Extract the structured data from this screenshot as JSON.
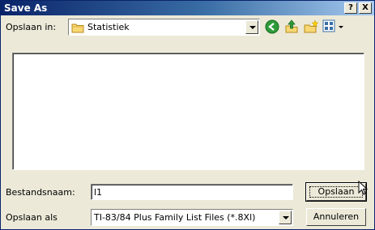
{
  "window": {
    "title": "Save As"
  },
  "titlebar_buttons": {
    "help": "?",
    "close": "X"
  },
  "lookin": {
    "label": "Opslaan in:",
    "folder": "Statistiek"
  },
  "toolbar": {
    "icons": [
      "back-icon",
      "up-folder-icon",
      "new-folder-icon",
      "views-menu-icon"
    ]
  },
  "filename": {
    "label": "Bestandsnaam:",
    "value": "l1"
  },
  "filetype": {
    "label": "Opslaan als",
    "value": "TI-83/84 Plus Family List Files (*.8Xl)"
  },
  "buttons": {
    "save": "Opslaan",
    "cancel": "Annuleren"
  },
  "colors": {
    "titlebar_start": "#0a246a",
    "titlebar_end": "#a6caf0",
    "dialog_bg": "#ece9d8"
  }
}
